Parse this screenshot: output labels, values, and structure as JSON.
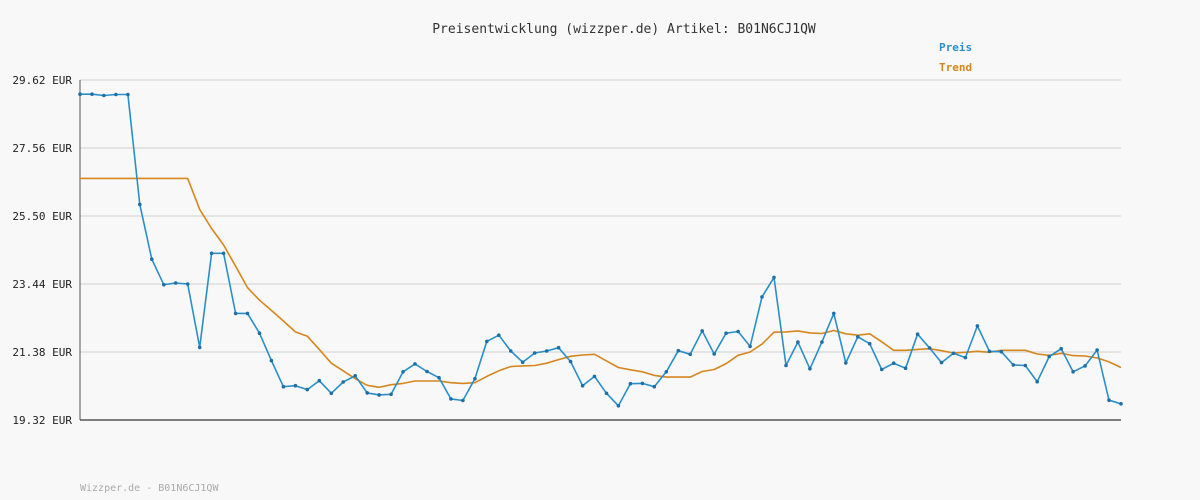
{
  "chart_data": {
    "type": "line",
    "title": "Preisentwicklung (wizzper.de) Artikel: B01N6CJ1QW",
    "ylabel": "",
    "xlabel": "",
    "ylim": [
      19.32,
      29.62
    ],
    "yticks": [
      "29.62 EUR",
      "27.56 EUR",
      "25.50 EUR",
      "23.44 EUR",
      "21.38 EUR",
      "19.32 EUR"
    ],
    "ytick_values": [
      29.62,
      27.56,
      25.5,
      23.44,
      21.38,
      19.32
    ],
    "grid": true,
    "legend": "top-right",
    "x": [
      1,
      2,
      3,
      4,
      5,
      6,
      7,
      8,
      9,
      10,
      11,
      12,
      13,
      14,
      15,
      16,
      17,
      18,
      19,
      20,
      21,
      22,
      23,
      24,
      25,
      26,
      27,
      28,
      29,
      30,
      31,
      32,
      33,
      34,
      35,
      36,
      37,
      38,
      39,
      40,
      41,
      42,
      43,
      44,
      45,
      46,
      47,
      48,
      49,
      50,
      51,
      52,
      53,
      54,
      55,
      56,
      57,
      58,
      59,
      60,
      61,
      62,
      63,
      64,
      65,
      66,
      67,
      68,
      69,
      70,
      71,
      72,
      73,
      74,
      75,
      76,
      77,
      78,
      79,
      80,
      81,
      82,
      83,
      84,
      85,
      86,
      87,
      88
    ],
    "series": [
      {
        "name": "Preis",
        "color": "#2a8fc9",
        "values": [
          29.19,
          29.19,
          29.15,
          29.18,
          29.18,
          25.85,
          24.19,
          23.42,
          23.47,
          23.44,
          21.52,
          24.37,
          24.37,
          22.55,
          22.55,
          21.95,
          21.12,
          20.33,
          20.36,
          20.24,
          20.51,
          20.13,
          20.47,
          20.66,
          20.14,
          20.08,
          20.1,
          20.78,
          21.02,
          20.79,
          20.6,
          19.96,
          19.91,
          20.57,
          21.7,
          21.89,
          21.41,
          21.07,
          21.35,
          21.41,
          21.51,
          21.09,
          20.36,
          20.64,
          20.13,
          19.75,
          20.42,
          20.43,
          20.33,
          20.78,
          21.42,
          21.31,
          22.02,
          21.32,
          21.95,
          22.0,
          21.55,
          23.05,
          23.64,
          20.97,
          21.68,
          20.87,
          21.68,
          22.55,
          21.05,
          21.84,
          21.63,
          20.85,
          21.04,
          20.89,
          21.92,
          21.5,
          21.06,
          21.34,
          21.21,
          22.17,
          21.4,
          21.39,
          20.99,
          20.97,
          20.48,
          21.24,
          21.48,
          20.78,
          20.96,
          21.44,
          19.92,
          19.81
        ],
        "data_labels": []
      },
      {
        "name": "Trend",
        "color": "#d6861d",
        "values": [
          26.64,
          26.64,
          26.64,
          26.64,
          26.64,
          26.64,
          26.64,
          26.64,
          26.64,
          26.64,
          25.7,
          25.12,
          24.62,
          23.98,
          23.33,
          22.95,
          22.64,
          22.32,
          21.99,
          21.86,
          21.46,
          21.04,
          20.81,
          20.57,
          20.37,
          20.31,
          20.39,
          20.43,
          20.5,
          20.5,
          20.5,
          20.45,
          20.43,
          20.45,
          20.64,
          20.81,
          20.94,
          20.96,
          20.97,
          21.04,
          21.15,
          21.25,
          21.29,
          21.31,
          21.11,
          20.91,
          20.84,
          20.78,
          20.67,
          20.62,
          20.62,
          20.62,
          20.79,
          20.85,
          21.03,
          21.28,
          21.38,
          21.62,
          21.98,
          21.99,
          22.02,
          21.96,
          21.94,
          22.03,
          21.93,
          21.89,
          21.93,
          21.69,
          21.43,
          21.43,
          21.46,
          21.48,
          21.42,
          21.35,
          21.37,
          21.4,
          21.37,
          21.43,
          21.43,
          21.43,
          21.32,
          21.28,
          21.34,
          21.27,
          21.26,
          21.2,
          21.08,
          20.91
        ]
      }
    ]
  },
  "legend": {
    "items": [
      {
        "label": "Preis",
        "color": "#2a8fc9"
      },
      {
        "label": "Trend",
        "color": "#d6861d"
      }
    ]
  },
  "footer": {
    "text": "Wizzper.de - B01N6CJ1QW"
  },
  "colors": {
    "axis": "#555555",
    "grid": "#dddddd",
    "background": "#f8f8f8"
  }
}
